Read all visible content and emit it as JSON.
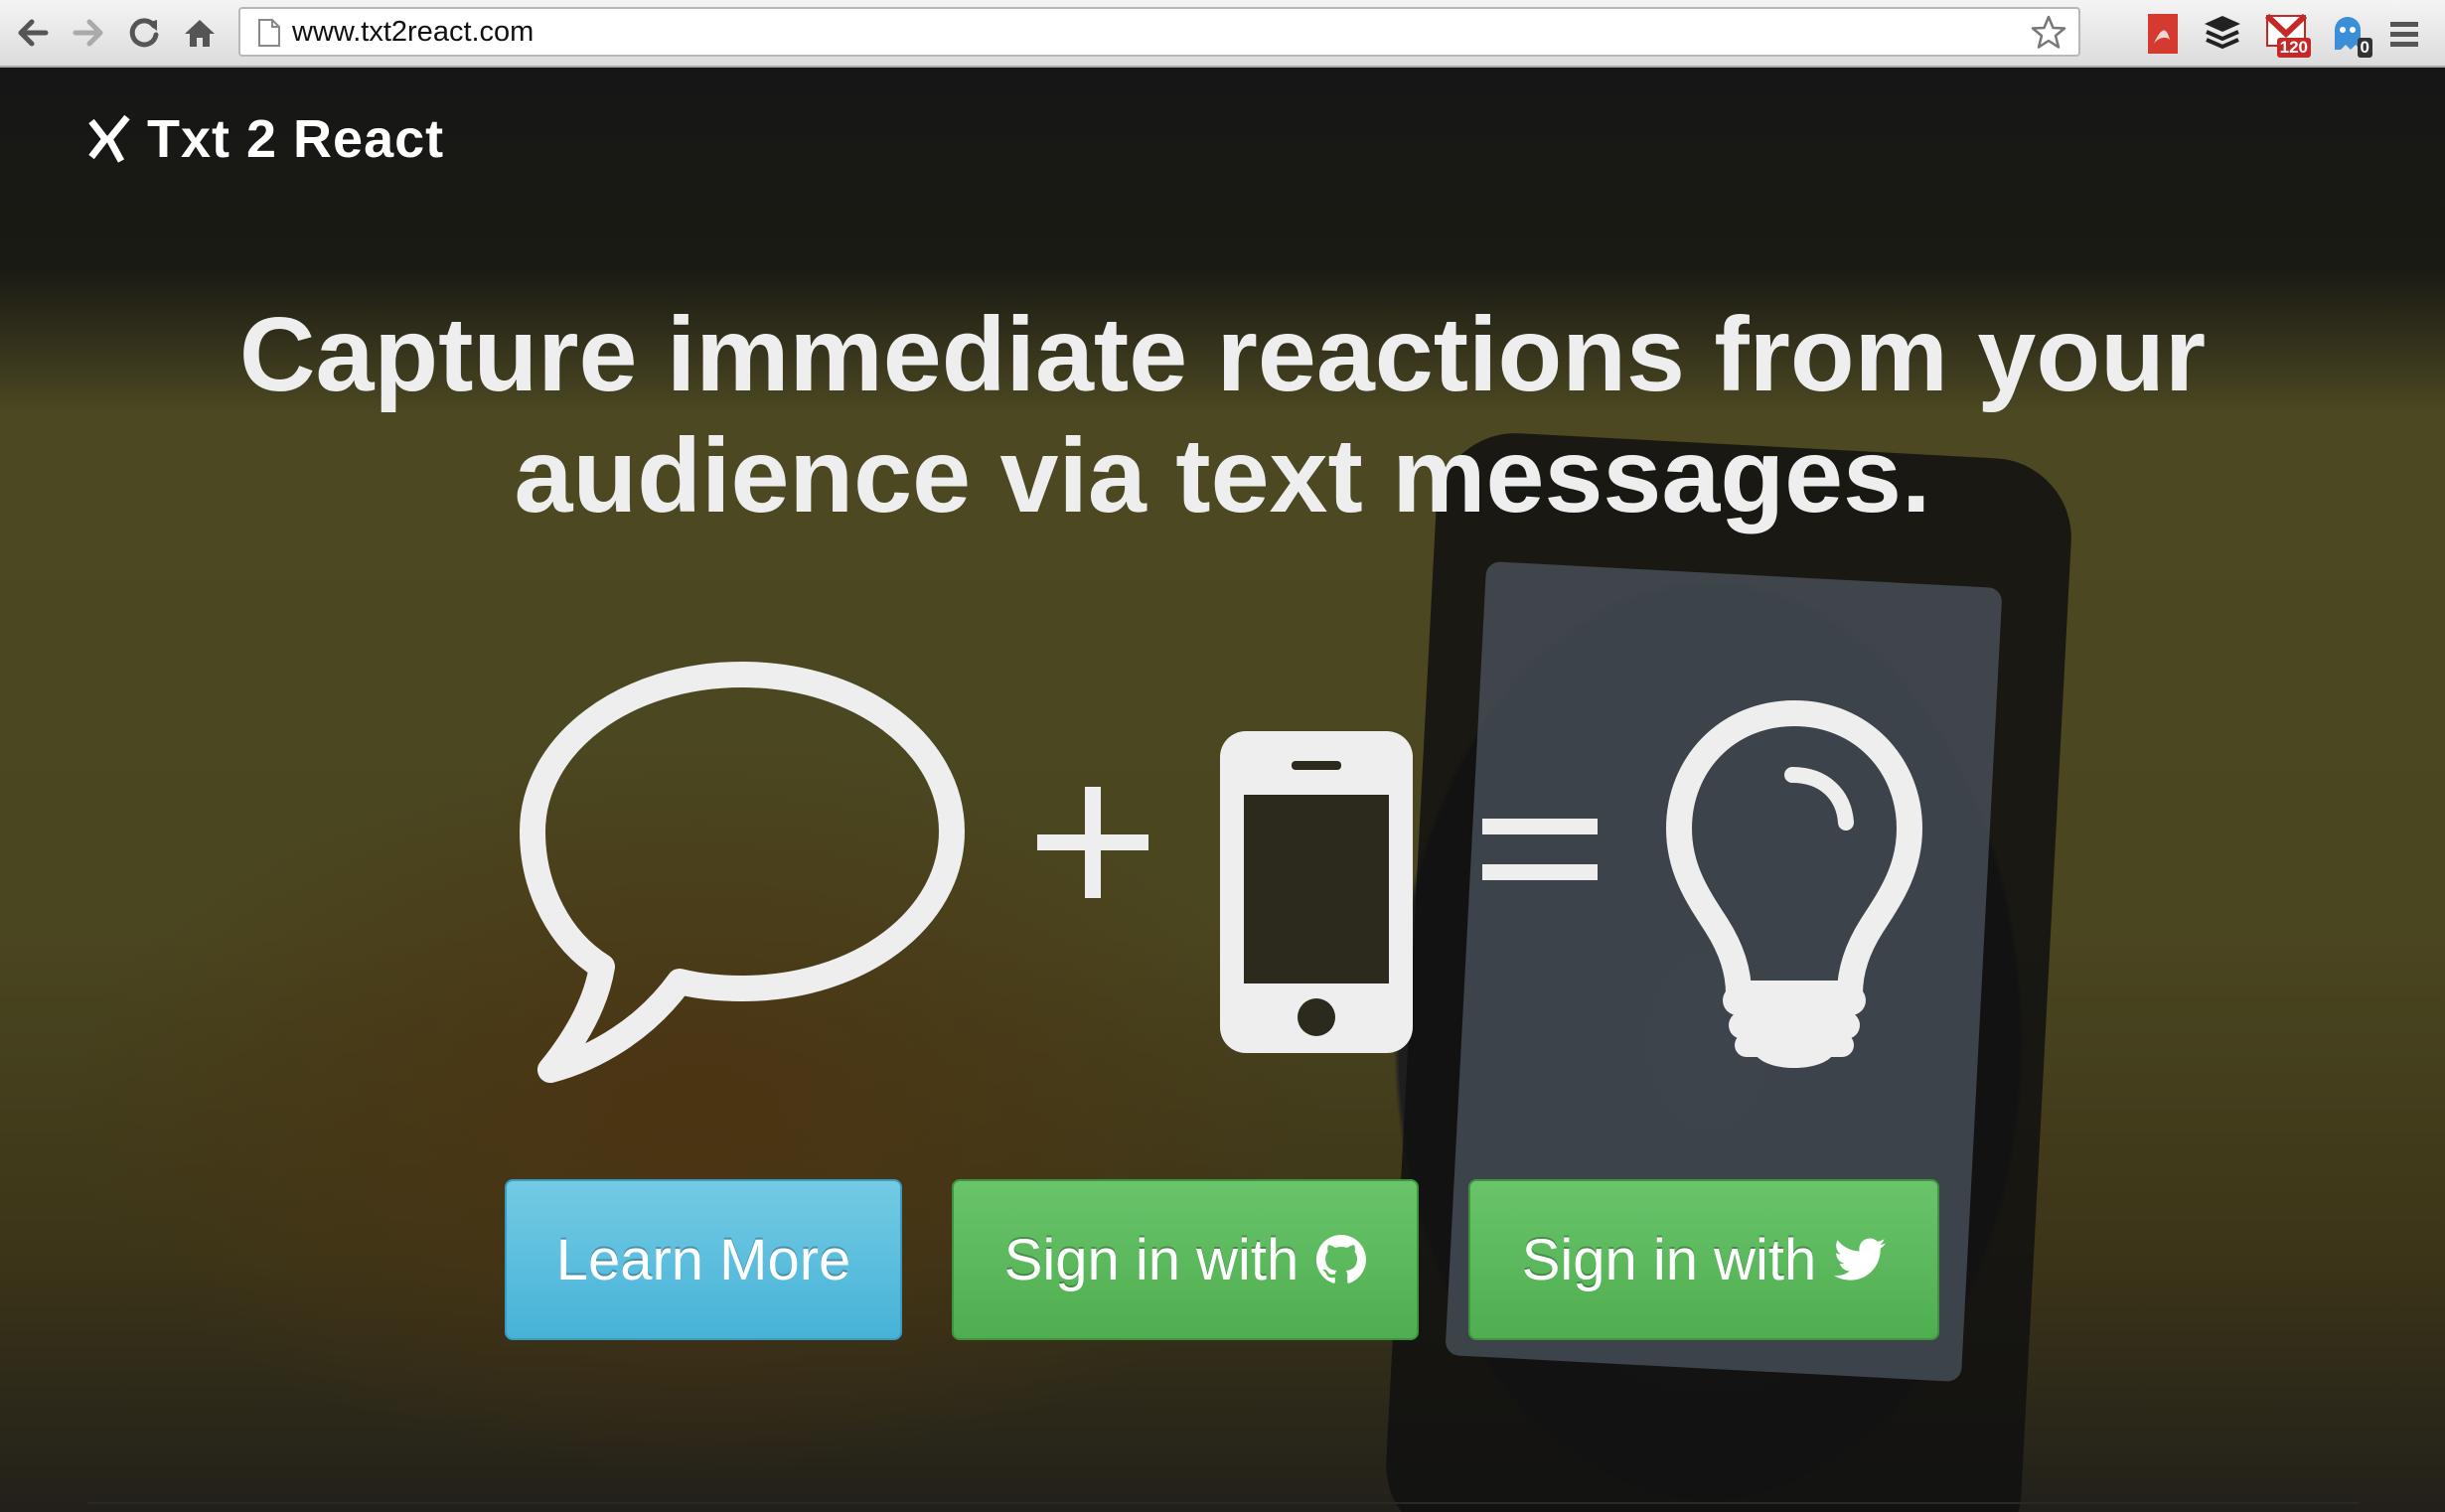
{
  "browser": {
    "url": "www.txt2react.com",
    "extensions": [
      {
        "icon": "pdf-extension-icon"
      },
      {
        "icon": "buffer-extension-icon"
      },
      {
        "icon": "gmail-extension-icon",
        "badge": "120"
      },
      {
        "icon": "ghostery-extension-icon",
        "badge": "0"
      }
    ]
  },
  "brand": {
    "name": "Txt 2 React"
  },
  "hero": {
    "headline_line1": "Capture immediate reactions from your",
    "headline_line2": "audience via text messages."
  },
  "equation": {
    "icons": [
      "speech-bubble-icon",
      "plus-icon",
      "smartphone-icon",
      "equals-icon",
      "lightbulb-icon"
    ]
  },
  "buttons": {
    "learn_more": "Learn More",
    "github_signin": "Sign in with",
    "twitter_signin": "Sign in with"
  },
  "colors": {
    "learn_more": "#5bc0de",
    "sign_in": "#5cb85c",
    "icon_fill": "#eeeeee"
  }
}
